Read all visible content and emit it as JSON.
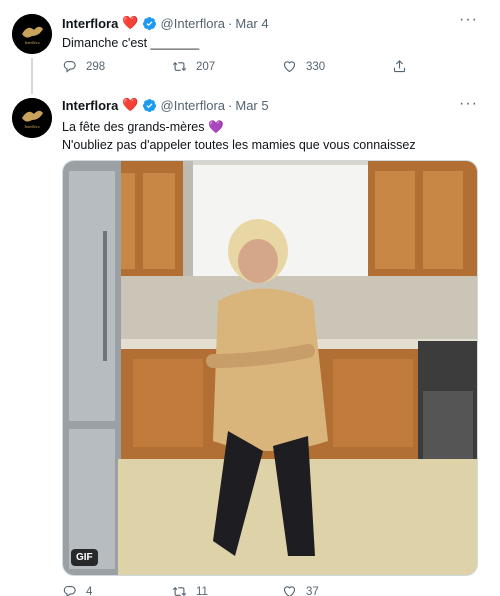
{
  "tweets": [
    {
      "display_name": "Interflora",
      "heart_emoji": "❤️",
      "handle": "@Interflora",
      "separator": "·",
      "date": "Mar 4",
      "text": "Dimanche c'est _______",
      "replies": "298",
      "retweets": "207",
      "likes": "330"
    },
    {
      "display_name": "Interflora",
      "heart_emoji": "❤️",
      "handle": "@Interflora",
      "separator": "·",
      "date": "Mar 5",
      "text_line1": "La fête des grands-mères",
      "text_line1_emoji": "💜",
      "text_line2": "N'oubliez pas d'appeler toutes les mamies que vous connaissez",
      "gif_badge": "GIF",
      "replies": "4",
      "retweets": "11",
      "likes": "37"
    }
  ],
  "more_label": "···",
  "avatar_text": "Interflora",
  "colors": {
    "verified": "#1d9bf0",
    "text": "#0f1419",
    "secondary": "#536471",
    "heart": "#e0245e",
    "purple_heart": "#8f67d6"
  }
}
